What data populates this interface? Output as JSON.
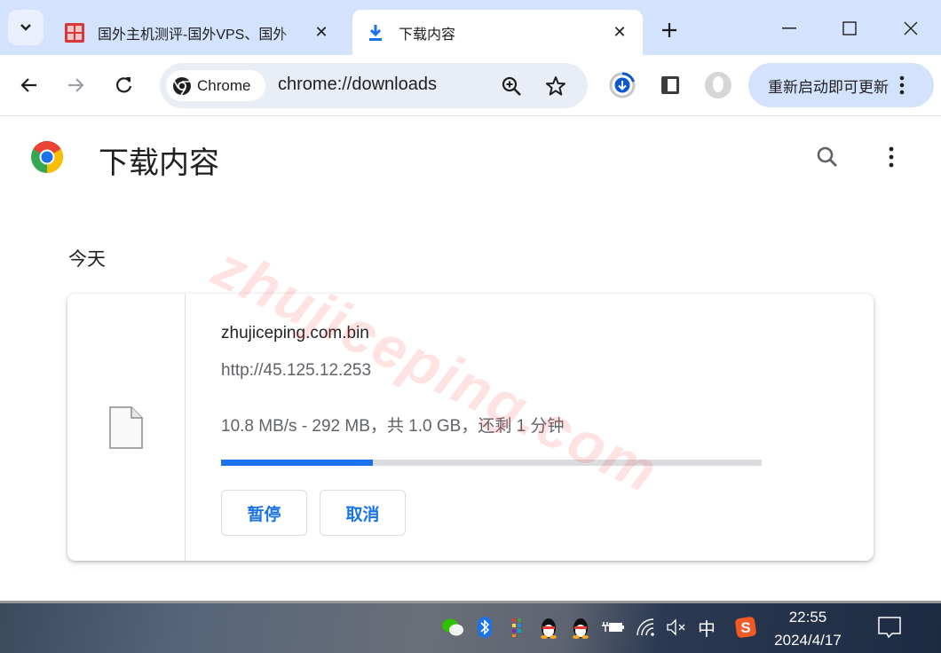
{
  "tabs": [
    {
      "title": "国外主机测评-国外VPS、国外",
      "active": false,
      "favicon": "site-seal-icon"
    },
    {
      "title": "下载内容",
      "active": true,
      "favicon": "download-icon"
    }
  ],
  "toolbar": {
    "chip_label": "Chrome",
    "url": "chrome://downloads",
    "update_label": "重新启动即可更新"
  },
  "page": {
    "title": "下载内容",
    "date_group": "今天",
    "watermark": "zhujiceping.com"
  },
  "download": {
    "file_name": "zhujiceping.com.bin",
    "source_url": "http://45.125.12.253",
    "status": "10.8 MB/s - 292 MB，共 1.0 GB，还剩 1 分钟",
    "progress_fraction": 0.28,
    "pause_label": "暂停",
    "cancel_label": "取消"
  },
  "colors": {
    "accent": "#1a73e8",
    "tabstrip": "#d3e3fd",
    "omnibox": "#e9eef6"
  },
  "taskbar": {
    "time": "22:55",
    "date": "2024/4/17",
    "ime": "中"
  }
}
